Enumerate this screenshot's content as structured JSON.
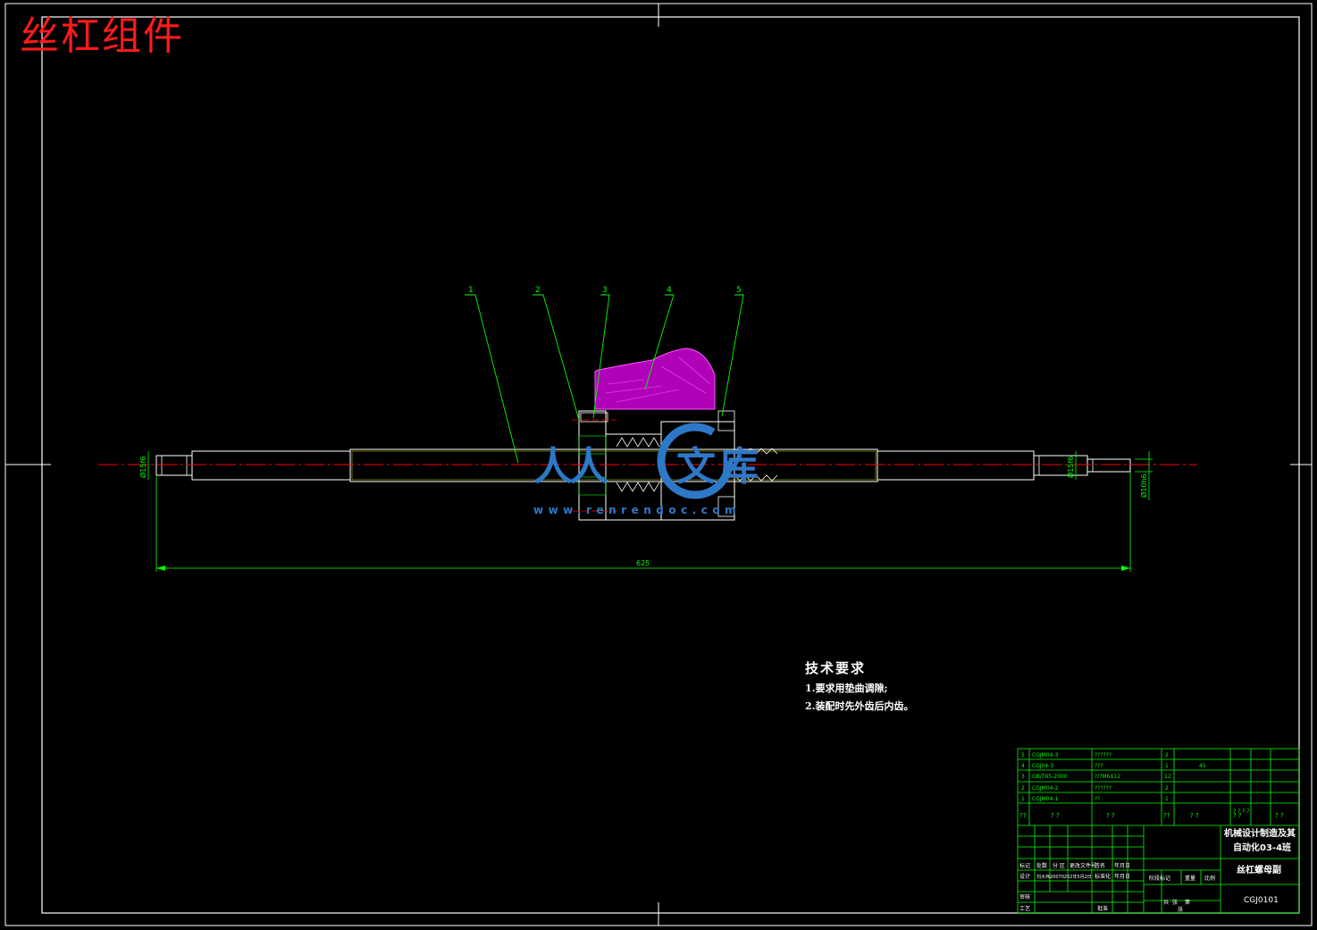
{
  "page_title": "丝杠组件",
  "balloons": [
    "1",
    "2",
    "3",
    "4",
    "5"
  ],
  "dimensions": {
    "overall_length": "625",
    "dia_left": "Ø15f6",
    "dia_right": "Ø15f6",
    "dia_tail": "Ø10h6"
  },
  "tech_requirements": {
    "heading": "技术要求",
    "items": [
      "1.要求用垫曲调隙;",
      "2.装配时先外齿后内齿。"
    ]
  },
  "watermark": {
    "text_a": "人人",
    "text_b": "文库",
    "url": "www.renrendoc.com",
    "color": "#2e78c8"
  },
  "bom": {
    "rows": [
      {
        "no": "5",
        "code": "CGJM04-3",
        "name": "??????",
        "qty": "2",
        "material": ""
      },
      {
        "no": "4",
        "code": "CGJ04-3",
        "name": "???",
        "qty": "1",
        "material": "45"
      },
      {
        "no": "3",
        "code": "GB/T65-2000",
        "name": "?/?M6X12",
        "qty": "12",
        "material": ""
      },
      {
        "no": "2",
        "code": "CGJM04-2",
        "name": "??????",
        "qty": "2",
        "material": ""
      },
      {
        "no": "1",
        "code": "CGJM04-1",
        "name": "??",
        "qty": "1",
        "material": ""
      }
    ],
    "header": {
      "no": "??",
      "code": "? ?",
      "name": "? ?",
      "qty": "??",
      "material": "? ?",
      "c6": "? ?",
      "c7": "? ?\n? ?",
      "c8": "? ?"
    }
  },
  "title_block": {
    "school": "机械设计制造及其",
    "class": "自动化03-4班",
    "drawing_name": "丝杠螺母副",
    "drawing_no": "CGJ0101",
    "label_row1": [
      "标记",
      "处数",
      "分 区",
      "更改文件号",
      "签名",
      "年月日"
    ],
    "label_row2": [
      "设计",
      "刘大伟20070202年5月2日",
      "",
      "标准化",
      "",
      "年月日"
    ],
    "label_stage": [
      "阶段标记",
      "重量",
      "比例"
    ],
    "label_review": "审核",
    "label_process": "工艺",
    "label_approve": "批准",
    "label_sheet": [
      "共",
      "张",
      "第",
      "张"
    ]
  },
  "colors": {
    "frame": "#ffffff",
    "green": "#00ff00",
    "red": "#ff0000",
    "magenta": "#c000c0",
    "yellow": "#ffff00"
  }
}
